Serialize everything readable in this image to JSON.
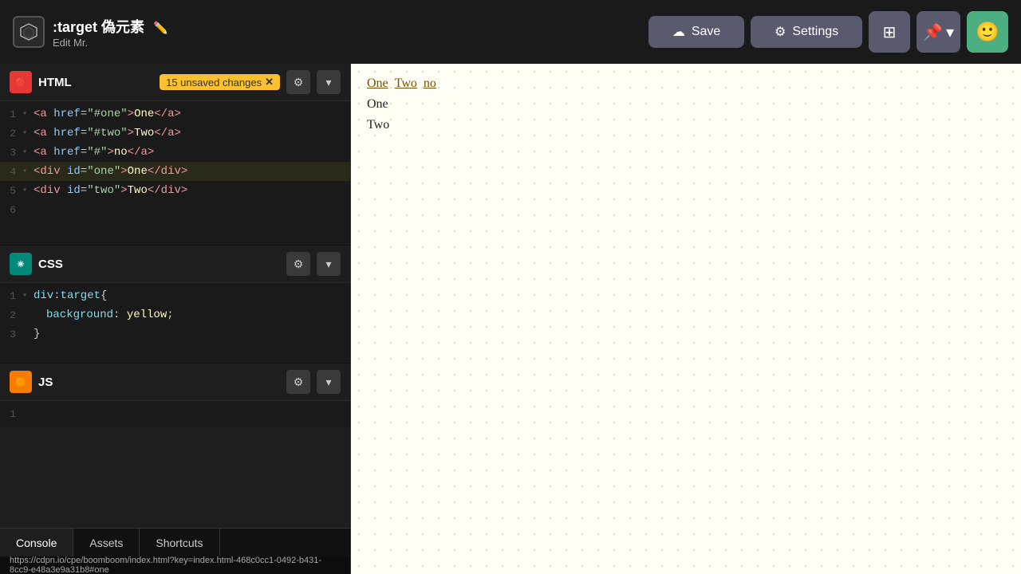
{
  "topbar": {
    "logo_icon": "⬡",
    "title": ":target 偽元素",
    "pencil": "✏",
    "subtitle": "Edit Mr.",
    "save_label": "Save",
    "settings_label": "Settings",
    "save_icon": "☁",
    "settings_icon": "⚙",
    "grid_icon": "⊞",
    "pin_icon": "📌",
    "chevron_down": "▾",
    "avatar_icon": "🙂"
  },
  "html_section": {
    "label": "HTML",
    "unsaved": "15 unsaved changes",
    "unsaved_x": "✕",
    "gear": "⚙",
    "chevron": "▾",
    "lines": [
      {
        "num": 1,
        "arrow": "▾",
        "content": "<a href=\"#one\">One</a>",
        "parts": [
          {
            "t": "tag",
            "v": "<a "
          },
          {
            "t": "attr",
            "v": "href"
          },
          {
            "t": "str",
            "v": "="
          },
          {
            "t": "str",
            "v": "\"#one\""
          },
          {
            "t": "tag",
            "v": ">"
          },
          {
            "t": "val",
            "v": "One"
          },
          {
            "t": "tag",
            "v": "</a>"
          }
        ]
      },
      {
        "num": 2,
        "arrow": "▾",
        "content": "<a href=\"#two\">Two</a>",
        "parts": [
          {
            "t": "tag",
            "v": "<a "
          },
          {
            "t": "attr",
            "v": "href"
          },
          {
            "t": "str",
            "v": "="
          },
          {
            "t": "str",
            "v": "\"#two\""
          },
          {
            "t": "tag",
            "v": ">"
          },
          {
            "t": "val",
            "v": "Two"
          },
          {
            "t": "tag",
            "v": "</a>"
          }
        ]
      },
      {
        "num": 3,
        "arrow": "▾",
        "content": "<a href=\"#\">no</a>",
        "parts": [
          {
            "t": "tag",
            "v": "<a "
          },
          {
            "t": "attr",
            "v": "href"
          },
          {
            "t": "str",
            "v": "="
          },
          {
            "t": "str",
            "v": "\"#\""
          },
          {
            "t": "tag",
            "v": ">"
          },
          {
            "t": "val",
            "v": "no"
          },
          {
            "t": "tag",
            "v": "</a>"
          }
        ]
      },
      {
        "num": 4,
        "arrow": "▾",
        "content": "<div id=\"one\">One</div>",
        "parts": [
          {
            "t": "tag",
            "v": "<div "
          },
          {
            "t": "attr",
            "v": "id"
          },
          {
            "t": "str",
            "v": "="
          },
          {
            "t": "str",
            "v": "\"one\""
          },
          {
            "t": "tag",
            "v": ">"
          },
          {
            "t": "val",
            "v": "One"
          },
          {
            "t": "tag",
            "v": "</div>"
          }
        ]
      },
      {
        "num": 5,
        "arrow": "▾",
        "content": "<div id=\"two\">Two</div>",
        "parts": [
          {
            "t": "tag",
            "v": "<div "
          },
          {
            "t": "attr",
            "v": "id"
          },
          {
            "t": "str",
            "v": "="
          },
          {
            "t": "str",
            "v": "\"two\""
          },
          {
            "t": "tag",
            "v": ">"
          },
          {
            "t": "val",
            "v": "Two"
          },
          {
            "t": "tag",
            "v": "</div>"
          }
        ]
      },
      {
        "num": 6,
        "arrow": "",
        "content": ""
      }
    ]
  },
  "css_section": {
    "label": "CSS",
    "gear": "⚙",
    "chevron": "▾",
    "lines": [
      {
        "num": 1,
        "arrow": "▾",
        "content": "div:target{"
      },
      {
        "num": 2,
        "arrow": "",
        "content": "    background: yellow;"
      },
      {
        "num": 3,
        "arrow": "",
        "content": "}"
      }
    ]
  },
  "js_section": {
    "label": "JS",
    "gear": "⚙",
    "chevron": "▾",
    "lines": [
      {
        "num": 1,
        "arrow": "",
        "content": ""
      }
    ]
  },
  "bottom_tabs": [
    {
      "label": "Console",
      "active": true
    },
    {
      "label": "Assets",
      "active": false
    },
    {
      "label": "Shortcuts",
      "active": false
    }
  ],
  "status_bar": {
    "url": "https://cdpn.io/cpe/boomboom/index.html?key=index.html-468c0cc1-0492-b431-8cc9-e48a3e9a31b8#one"
  },
  "preview": {
    "links": [
      {
        "label": "One",
        "href": "#one",
        "active": true
      },
      {
        "label": "Two",
        "href": "#two",
        "active": false
      },
      {
        "label": "no",
        "href": "#",
        "active": false
      }
    ],
    "items": [
      {
        "label": "One",
        "highlighted": false
      },
      {
        "label": "Two",
        "highlighted": false
      }
    ]
  }
}
